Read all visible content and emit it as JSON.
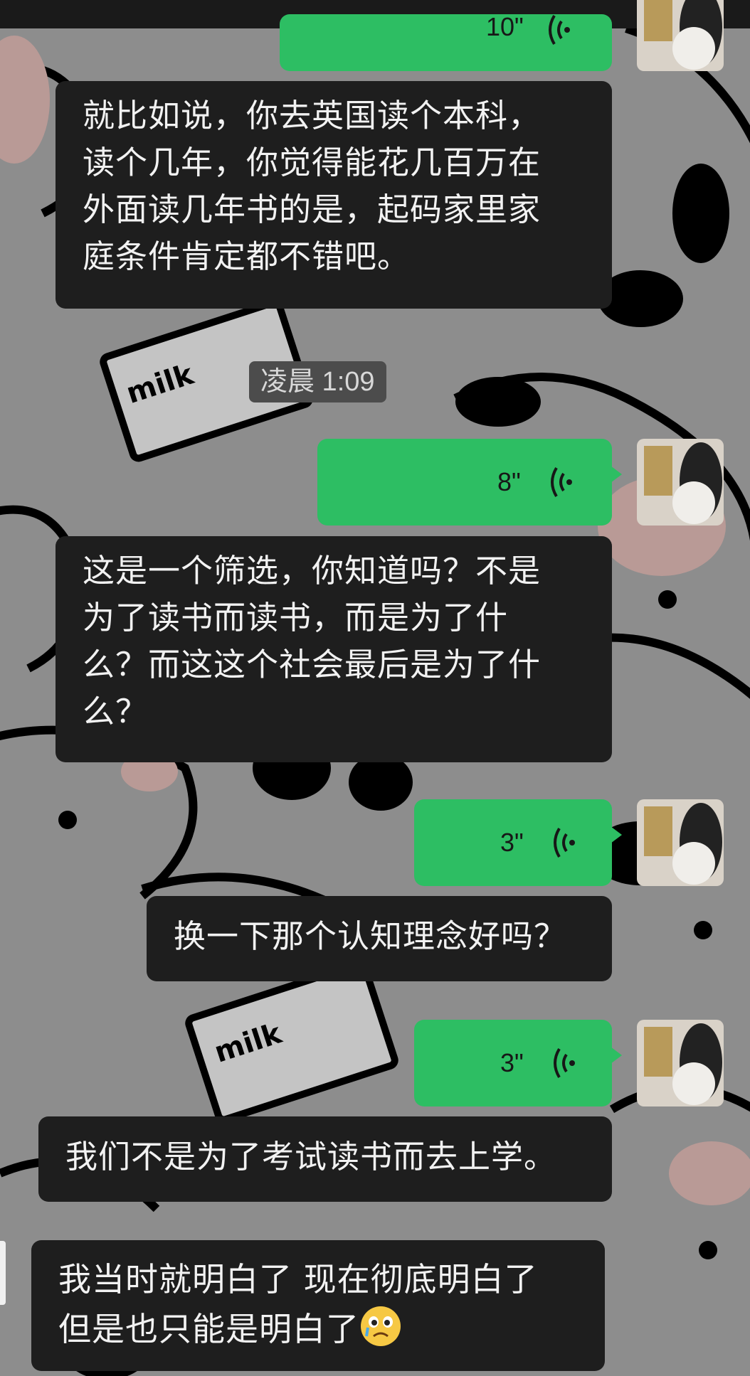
{
  "timestamp": "凌晨 1:09",
  "voice_messages": [
    {
      "duration": "10\""
    },
    {
      "duration": "8\""
    },
    {
      "duration": "3\""
    },
    {
      "duration": "3\""
    }
  ],
  "received_messages": [
    {
      "lines": [
        "就比如说，你去英国读个本科，",
        "读个几年，你觉得能花几百万在",
        "外面读几年书的是，起码家里家",
        "庭条件肯定都不错吧。"
      ]
    },
    {
      "lines": [
        "这是一个筛选，你知道吗？不是",
        "为了读书而读书，而是为了什",
        "么？而这这个社会最后是为了什",
        "么？"
      ]
    },
    {
      "lines": [
        "换一下那个认知理念好吗？"
      ]
    },
    {
      "lines": [
        "我们不是为了考试读书而去上学。"
      ]
    }
  ],
  "overlay_comment": {
    "lines": [
      "我当时就明白了 现在彻底明白了",
      "但是也只能是明白了"
    ],
    "emoji": "crying-face-emoji"
  },
  "background_text": [
    "milk",
    "milk"
  ],
  "colors": {
    "voice_bubble": "#2dbe63",
    "text_bubble": "#1e1e1e",
    "background": "#8d8d8d"
  }
}
